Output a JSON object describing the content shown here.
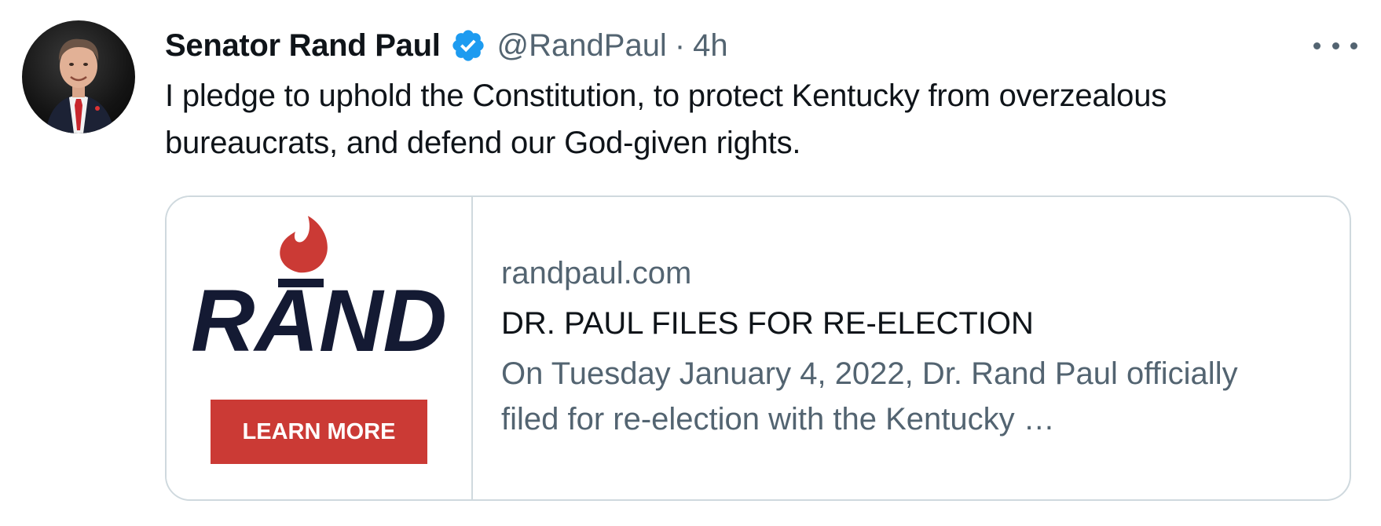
{
  "author": {
    "display_name": "Senator Rand Paul",
    "handle": "@RandPaul",
    "separator": "·",
    "time": "4h",
    "verified": true,
    "avatar_icon": "profile-photo"
  },
  "tweet": {
    "text": "I pledge to uphold the Constitution, to protect Kentucky from overzealous bureaucrats, and defend our God-given rights."
  },
  "more_menu_icon": "more-horizontal-icon",
  "link_card": {
    "image": {
      "logo_text": "RAND",
      "button_label": "LEARN MORE"
    },
    "domain": "randpaul.com",
    "title": "DR. PAUL FILES FOR RE-ELECTION",
    "description": "On Tuesday January 4, 2022, Dr. Rand Paul officially filed for re-election with the Kentucky …"
  },
  "colors": {
    "verified_blue": "#1d9bf0",
    "secondary_text": "#536471",
    "primary_text": "#0f1419",
    "brand_red": "#cb3a35",
    "brand_navy": "#141a33",
    "card_border": "#cfd9de"
  }
}
